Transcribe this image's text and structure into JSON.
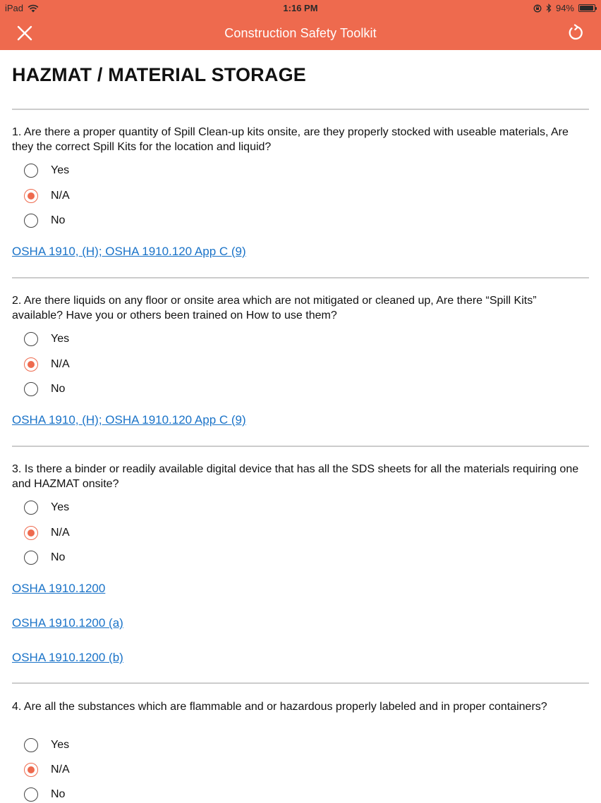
{
  "status_bar": {
    "device": "iPad",
    "time": "1:16 PM",
    "battery": "94%"
  },
  "nav": {
    "title": "Construction Safety Toolkit",
    "close_icon": "close-icon",
    "refresh_icon": "refresh-icon"
  },
  "colors": {
    "accent": "#ee6a4e",
    "link": "#1a73c8"
  },
  "page": {
    "title": "HAZMAT / MATERIAL STORAGE"
  },
  "questions": [
    {
      "text": "1. Are there a proper quantity of Spill Clean-up kits onsite, are they properly stocked with useable materials,  Are they the correct Spill Kits for the location and liquid?",
      "options": [
        "Yes",
        "N/A",
        "No"
      ],
      "selected": "N/A",
      "links": [
        "OSHA 1910, (H); OSHA 1910.120 App C (9)"
      ]
    },
    {
      "text": "2. Are there liquids on any floor or onsite area which are not mitigated or cleaned up, Are there “Spill Kits” available?  Have you or others been trained on How to use them?",
      "options": [
        "Yes",
        "N/A",
        "No"
      ],
      "selected": "N/A",
      "links": [
        "OSHA 1910, (H); OSHA 1910.120 App C (9)"
      ]
    },
    {
      "text": "3. Is there a binder or readily available digital device that has all the SDS sheets for all the materials requiring one and HAZMAT onsite?",
      "options": [
        "Yes",
        "N/A",
        "No"
      ],
      "selected": "N/A",
      "links": [
        "OSHA 1910.1200",
        "OSHA 1910.1200 (a)",
        "OSHA 1910.1200 (b)"
      ]
    },
    {
      "text": "4. Are all the substances which are flammable and or hazardous properly labeled and in proper containers?",
      "options": [
        "Yes",
        "N/A",
        "No"
      ],
      "selected": "N/A",
      "links": []
    }
  ]
}
